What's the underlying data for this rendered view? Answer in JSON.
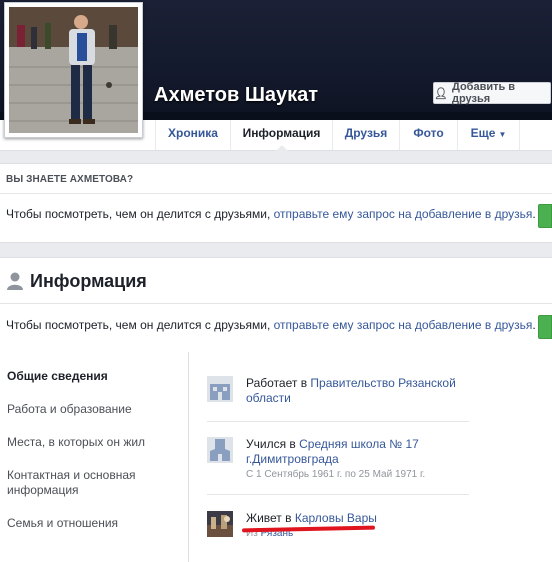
{
  "profile": {
    "name": "Ахметов Шаукат",
    "add_friend": "Добавить в друзья"
  },
  "tabs": [
    {
      "label": "Хроника"
    },
    {
      "label": "Информация"
    },
    {
      "label": "Друзья"
    },
    {
      "label": "Фото"
    },
    {
      "label": "Еще"
    }
  ],
  "know": {
    "heading": "ВЫ ЗНАЕТЕ АХМЕТОВА?",
    "text": "Чтобы посмотреть, чем он делится с друзьями, ",
    "link": "отправьте ему запрос на добавление в друзья",
    "end": "."
  },
  "info": {
    "title": "Информация",
    "text": "Чтобы посмотреть, чем он делится с друзьями, ",
    "link": "отправьте ему запрос на добавление в друзья",
    "end": "."
  },
  "sidebar": [
    {
      "label": "Общие сведения"
    },
    {
      "label": "Работа и образование"
    },
    {
      "label": "Места, в которых он жил"
    },
    {
      "label": "Контактная и основная информация"
    },
    {
      "label": "Семья и отношения"
    }
  ],
  "entries": {
    "work": {
      "prefix": "Работает в ",
      "link": "Правительство Рязанской области"
    },
    "school": {
      "prefix": "Учился в ",
      "link": "Средняя школа № 17 г.Димитровграда",
      "sub": "С 1 Сентябрь 1961 г. по 25 Май 1971 г."
    },
    "lives": {
      "prefix": "Живет в ",
      "link": "Карловы Вары",
      "sub_prefix": "Из ",
      "sub_link": "Рязань"
    }
  },
  "colors": {
    "link": "#365899",
    "green": "#4bb04f",
    "underline": "#e0141e"
  }
}
